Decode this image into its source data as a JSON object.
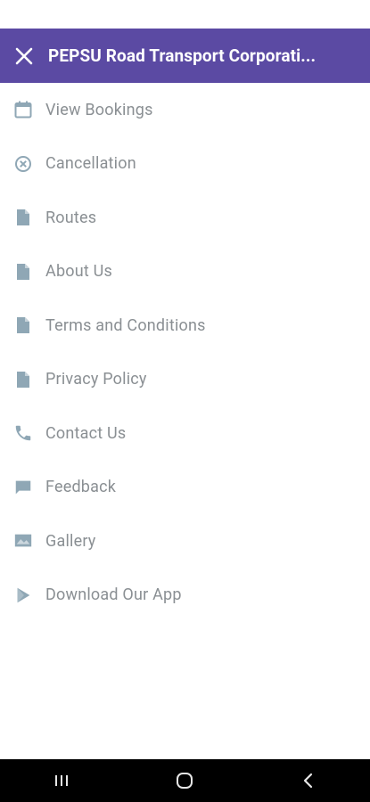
{
  "header": {
    "title": "PEPSU Road Transport Corporati...",
    "bg_color": "#5b4aa3"
  },
  "menu": {
    "icon_color": "#8fa7b5",
    "text_color": "#8a8f93",
    "items": [
      {
        "label": "View Bookings",
        "icon": "calendar-icon"
      },
      {
        "label": "Cancellation",
        "icon": "cancel-circle-icon"
      },
      {
        "label": "Routes",
        "icon": "document-icon"
      },
      {
        "label": "About Us",
        "icon": "document-icon"
      },
      {
        "label": "Terms and Conditions",
        "icon": "document-icon"
      },
      {
        "label": "Privacy Policy",
        "icon": "document-icon"
      },
      {
        "label": "Contact Us",
        "icon": "phone-icon"
      },
      {
        "label": "Feedback",
        "icon": "chat-bubble-icon"
      },
      {
        "label": "Gallery",
        "icon": "image-icon"
      },
      {
        "label": "Download Our App",
        "icon": "play-store-icon"
      }
    ]
  },
  "navbar": {
    "buttons": [
      "recent-apps",
      "home",
      "back"
    ]
  }
}
